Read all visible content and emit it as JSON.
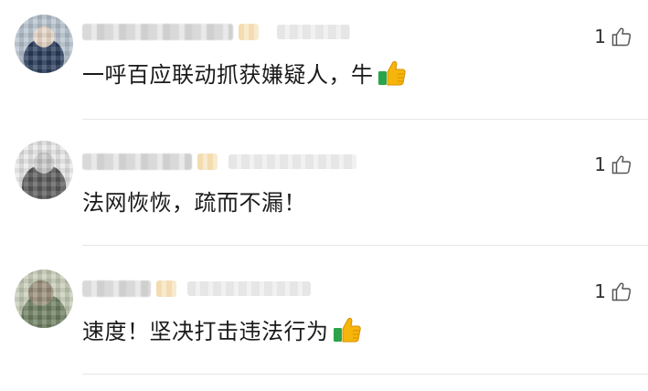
{
  "comments": [
    {
      "text": "一呼百应联动抓获嫌疑人，牛",
      "likes": "1",
      "emoji": "thumbs-up",
      "name_width": 165,
      "time_width": 80
    },
    {
      "text": "法网恢恢，疏而不漏！",
      "likes": "1",
      "emoji": null,
      "name_width": 120,
      "time_width": 140
    },
    {
      "text": "速度！坚决打击违法行为",
      "likes": "1",
      "emoji": "thumbs-up",
      "name_width": 75,
      "time_width": 135
    }
  ],
  "colors": {
    "text": "#1a1a1a",
    "divider": "#e6e6e6",
    "emoji_yellow": "#f5b50a",
    "emoji_green": "#2aa44a"
  }
}
